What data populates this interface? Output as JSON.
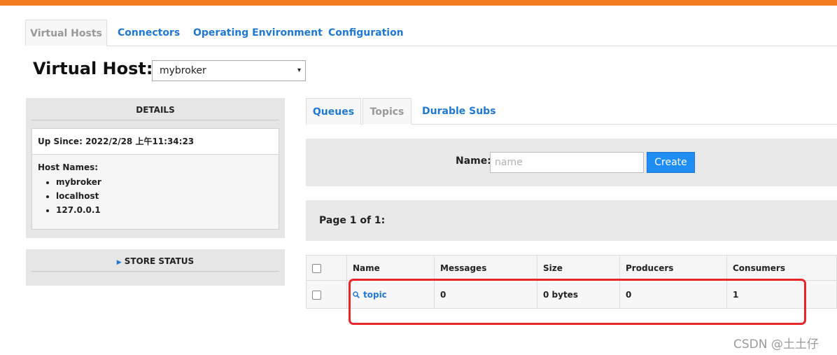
{
  "nav": {
    "tabs": [
      "Virtual Hosts",
      "Connectors",
      "Operating Environment",
      "Configuration"
    ],
    "active": "Virtual Hosts"
  },
  "virtual_host": {
    "label": "Virtual Host:",
    "selected": "mybroker",
    "caret": "▾"
  },
  "details": {
    "title": "DETAILS",
    "up_since_label": "Up Since:",
    "up_since_value": "2022/2/28 上午11:34:23",
    "host_names_label": "Host Names:",
    "host_names": [
      "mybroker",
      "localhost",
      "127.0.0.1"
    ]
  },
  "store_status": {
    "title": "STORE STATUS",
    "icon": "caret-right-icon"
  },
  "sub_tabs": {
    "tabs": [
      "Queues",
      "Topics",
      "Durable Subs"
    ],
    "active": "Topics"
  },
  "create": {
    "label": "Name:",
    "placeholder": "name",
    "button": "Create"
  },
  "pagination": {
    "text": "Page 1 of 1:"
  },
  "table": {
    "headers": [
      "Name",
      "Messages",
      "Size",
      "Producers",
      "Consumers"
    ],
    "rows": [
      {
        "name": "topic",
        "messages": "0",
        "size": "0 bytes",
        "producers": "0",
        "consumers": "1"
      }
    ]
  },
  "colors": {
    "brand_bar": "#f47b20",
    "link": "#1f78d1",
    "button": "#1e8ef5",
    "highlight": "#e8262a"
  },
  "watermark": "CSDN @土土仔"
}
